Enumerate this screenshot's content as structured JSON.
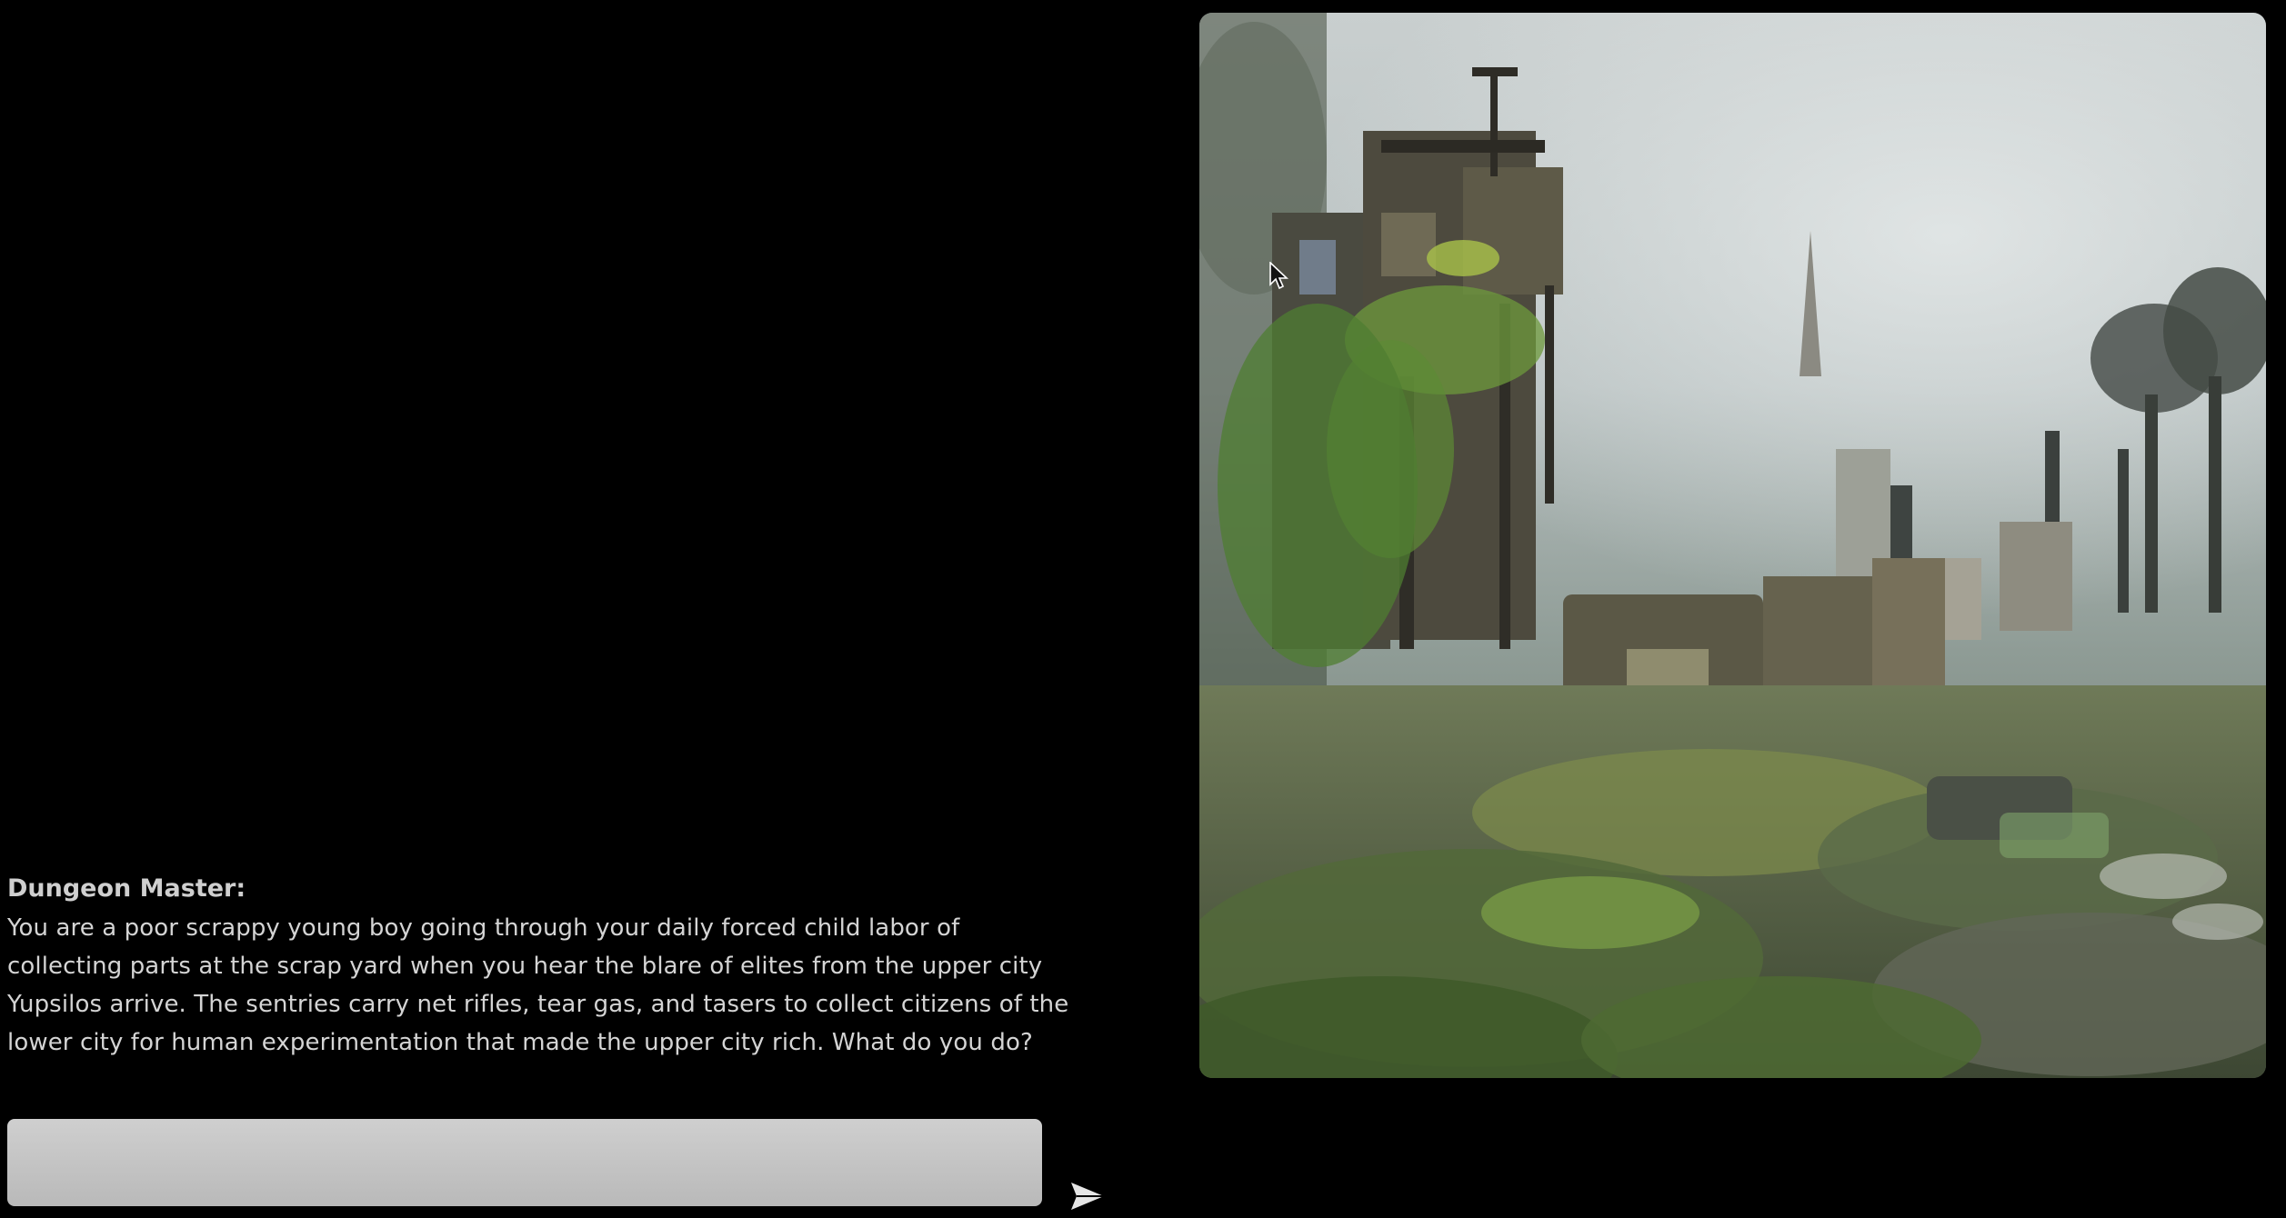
{
  "story": {
    "speaker": "Dungeon Master:",
    "lines": [
      "You are a poor scrappy young boy going through your daily forced child labor of",
      "collecting parts at the scrap yard when you hear the blare of elites from the upper city",
      "Yupsilos arrive. The sentries carry net rifles, tear gas, and tasers to collect citizens of the",
      "lower city for human experimentation that made the upper city rich. What do you do?"
    ]
  },
  "input": {
    "value": "",
    "placeholder": ""
  },
  "send": {
    "icon": "paper-plane-icon"
  },
  "scene": {
    "icon": "generated-scene-image"
  },
  "cursor": {
    "icon": "mouse-pointer-icon"
  },
  "colors": {
    "background": "#000000",
    "text": "#d4d4d4",
    "input_fill": "#c4c4c4",
    "send_icon": "#e6e6e6"
  }
}
